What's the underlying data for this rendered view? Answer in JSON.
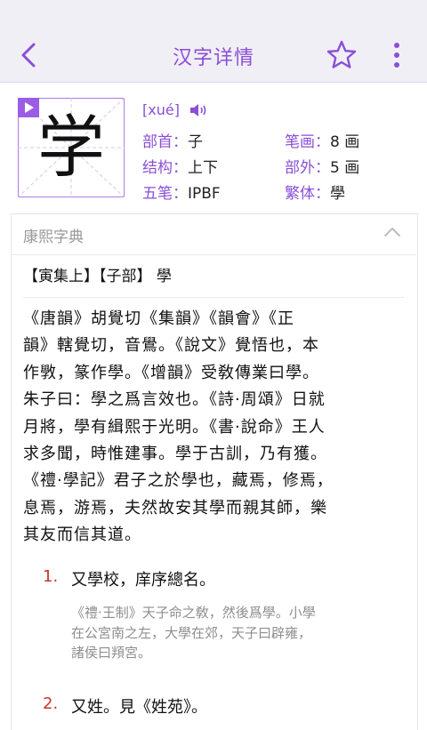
{
  "header": {
    "title": "汉字详情",
    "back_icon": "chevron-left-icon",
    "star_icon": "star-outline-icon",
    "more_icon": "vertical-ellipsis-icon",
    "accent_color": "#8a4fd6"
  },
  "character": {
    "glyph": "学",
    "pinyin": "[xué]",
    "play_icon": "play-icon",
    "speaker_icon": "speaker-icon",
    "fields": [
      {
        "label": "部首：",
        "value": "子"
      },
      {
        "label": "笔画：",
        "value": "8 画"
      },
      {
        "label": "结构：",
        "value": "上下"
      },
      {
        "label": "部外：",
        "value": "5 画"
      },
      {
        "label": "五笔：",
        "value": "IPBF"
      },
      {
        "label": "繁体：",
        "value": "學"
      }
    ]
  },
  "kangxi": {
    "title": "康熙字典",
    "section": "【寅集上】【子部】 學",
    "paragraph_lines": [
      "《唐韻》胡覺切《集韻》《韻會》《正",
      "韻》轄覺切，音鷽。《說文》覺悟也，本",
      "作斆，篆作學。《增韻》受敎傳業曰學。",
      "朱子曰：學之爲言效也。《詩·周頌》日就",
      "月將，學有緝熙于光明。《書·說命》王人",
      "求多聞，時惟建事。學于古訓，乃有獲。",
      "《禮·學記》君子之於學也，藏焉，修焉，",
      "息焉，游焉，夫然故安其學而親其師，樂",
      "其友而信其道。"
    ],
    "definitions": [
      {
        "num": "1.",
        "text": "又學校，庠序總名。",
        "quote_lines": [
          "《禮·王制》天子命之敎，然後爲學。小學",
          "在公宮南之左，大學在郊，天子曰辟雍，",
          "諸侯曰頖宮。"
        ]
      },
      {
        "num": "2.",
        "text": "又姓。見《姓苑》。"
      }
    ]
  }
}
